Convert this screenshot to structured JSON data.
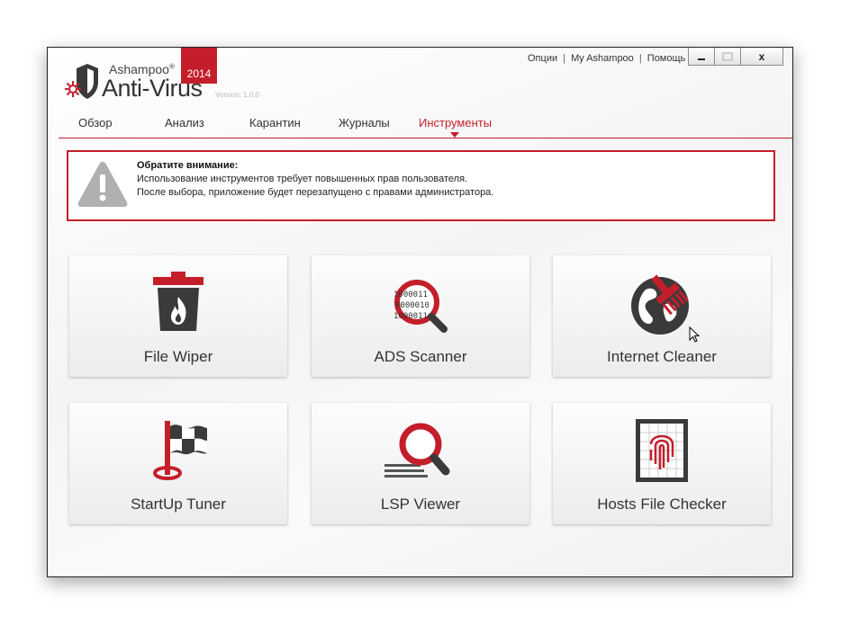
{
  "app": {
    "brand": "Ashampoo",
    "brand_mark": "®",
    "product": "Anti-Virus",
    "year": "2014",
    "version": "Version: 1.0.0"
  },
  "top_links": {
    "options": "Опции",
    "my_ashampoo": "My Ashampoo",
    "help": "Помощь",
    "separator": "|"
  },
  "window_controls": {
    "close": "x"
  },
  "nav": {
    "tabs": [
      {
        "label": "Обзор",
        "active": false
      },
      {
        "label": "Анализ",
        "active": false
      },
      {
        "label": "Карантин",
        "active": false
      },
      {
        "label": "Журналы",
        "active": false
      },
      {
        "label": "Инструменты",
        "active": true
      }
    ]
  },
  "warning": {
    "title": "Обратите внимание:",
    "line1": "Использование инструментов требует повышенных прав пользователя.",
    "line2": "После выбора, приложение будет перезапущено с правами администратора."
  },
  "tools": [
    {
      "label": "File Wiper",
      "icon": "trash-flame-icon"
    },
    {
      "label": "ADS Scanner",
      "icon": "binary-magnifier-icon"
    },
    {
      "label": "Internet Cleaner",
      "icon": "globe-brush-icon"
    },
    {
      "label": "StartUp Tuner",
      "icon": "flag-icon"
    },
    {
      "label": "LSP Viewer",
      "icon": "magnifier-icon"
    },
    {
      "label": "Hosts File Checker",
      "icon": "fingerprint-icon"
    }
  ],
  "colors": {
    "accent": "#c41e2a",
    "icon_dark": "#3a3a3a"
  }
}
